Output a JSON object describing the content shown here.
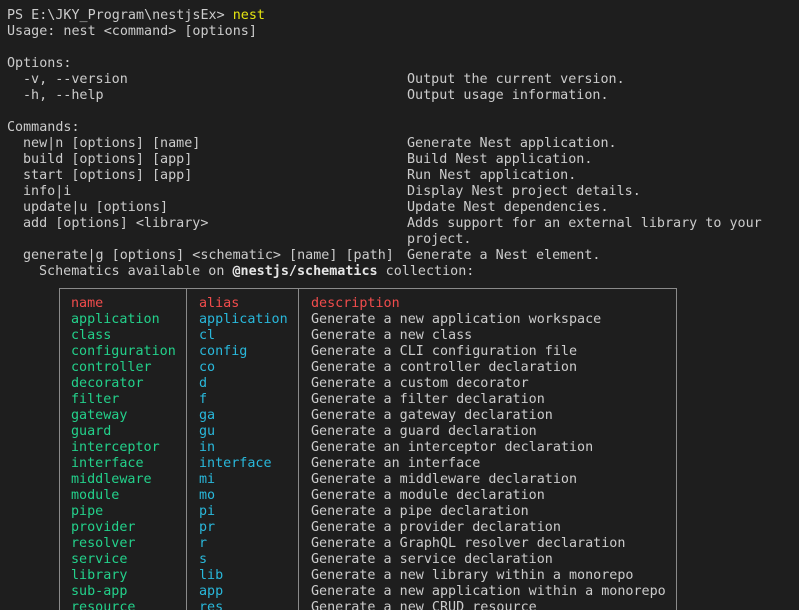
{
  "prompt": {
    "path": "PS E:\\JKY_Program\\nestjsEx>",
    "command": "nest"
  },
  "usage": "Usage: nest <command> [options]",
  "options_header": "Options:",
  "options": [
    {
      "flag": "-v, --version",
      "desc": "Output the current version."
    },
    {
      "flag": "-h, --help",
      "desc": "Output usage information."
    }
  ],
  "commands_header": "Commands:",
  "commands": [
    {
      "name": "new|n [options] [name]",
      "desc": "Generate Nest application."
    },
    {
      "name": "build [options] [app]",
      "desc": "Build Nest application."
    },
    {
      "name": "start [options] [app]",
      "desc": "Run Nest application."
    },
    {
      "name": "info|i",
      "desc": "Display Nest project details."
    },
    {
      "name": "update|u [options]",
      "desc": "Update Nest dependencies."
    },
    {
      "name": "add [options] <library>",
      "desc": "Adds support for an external library to your",
      "desc2": "project."
    },
    {
      "name": "generate|g [options] <schematic> [name] [path]",
      "desc": "Generate a Nest element."
    }
  ],
  "schematics_note": {
    "prefix": "Schematics available on ",
    "collection": "@nestjs/schematics",
    "suffix": " collection:"
  },
  "table": {
    "headers": {
      "name": "name",
      "alias": "alias",
      "description": "description"
    },
    "rows": [
      {
        "name": "application",
        "alias": "application",
        "description": "Generate a new application workspace"
      },
      {
        "name": "class",
        "alias": "cl",
        "description": "Generate a new class"
      },
      {
        "name": "configuration",
        "alias": "config",
        "description": "Generate a CLI configuration file"
      },
      {
        "name": "controller",
        "alias": "co",
        "description": "Generate a controller declaration"
      },
      {
        "name": "decorator",
        "alias": "d",
        "description": "Generate a custom decorator"
      },
      {
        "name": "filter",
        "alias": "f",
        "description": "Generate a filter declaration"
      },
      {
        "name": "gateway",
        "alias": "ga",
        "description": "Generate a gateway declaration"
      },
      {
        "name": "guard",
        "alias": "gu",
        "description": "Generate a guard declaration"
      },
      {
        "name": "interceptor",
        "alias": "in",
        "description": "Generate an interceptor declaration"
      },
      {
        "name": "interface",
        "alias": "interface",
        "description": "Generate an interface"
      },
      {
        "name": "middleware",
        "alias": "mi",
        "description": "Generate a middleware declaration"
      },
      {
        "name": "module",
        "alias": "mo",
        "description": "Generate a module declaration"
      },
      {
        "name": "pipe",
        "alias": "pi",
        "description": "Generate a pipe declaration"
      },
      {
        "name": "provider",
        "alias": "pr",
        "description": "Generate a provider declaration"
      },
      {
        "name": "resolver",
        "alias": "r",
        "description": "Generate a GraphQL resolver declaration"
      },
      {
        "name": "service",
        "alias": "s",
        "description": "Generate a service declaration"
      },
      {
        "name": "library",
        "alias": "lib",
        "description": "Generate a new library within a monorepo"
      },
      {
        "name": "sub-app",
        "alias": "app",
        "description": "Generate a new application within a monorepo"
      },
      {
        "name": "resource",
        "alias": "res",
        "description": "Generate a new CRUD resource"
      }
    ]
  }
}
